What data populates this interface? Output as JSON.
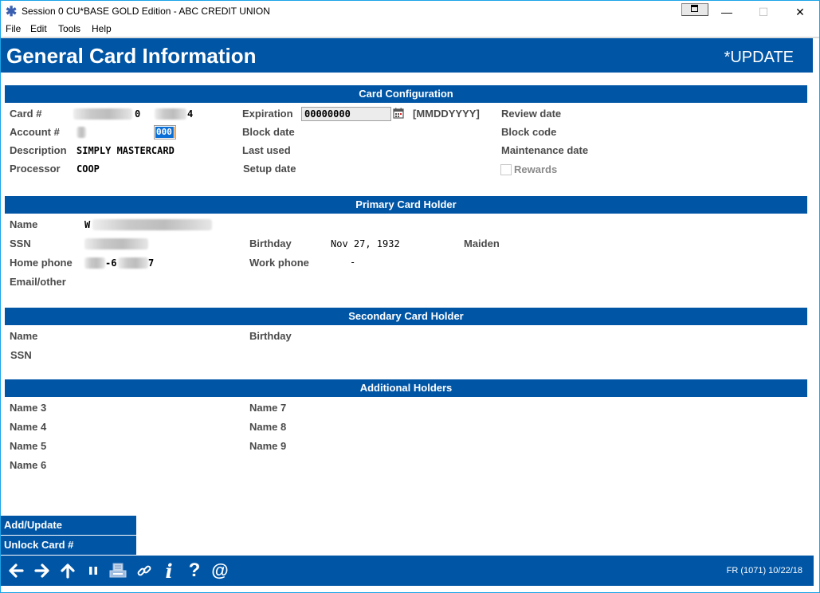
{
  "window": {
    "title": "Session 0 CU*BASE GOLD Edition - ABC CREDIT UNION",
    "controls": {
      "minimize": "—",
      "maximize": "☐",
      "close": "✕"
    }
  },
  "menu": [
    "File",
    "Edit",
    "Tools",
    "Help"
  ],
  "header": {
    "title": "General Card Information",
    "mode": "*UPDATE"
  },
  "card_configuration": {
    "title": "Card Configuration",
    "card_label": "Card #",
    "card_value_suffix_1": "0",
    "card_value_suffix_2": "4",
    "account_label": "Account #",
    "account_sub_value": "000",
    "description_label": "Description",
    "description_value": "SIMPLY MASTERCARD",
    "processor_label": "Processor",
    "processor_value": "COOP",
    "expiration_label": "Expiration",
    "expiration_value": "00000000",
    "expiration_format": "[MMDDYYYY]",
    "block_date_label": "Block date",
    "last_used_label": "Last used",
    "setup_date_label": "Setup date",
    "review_date_label": "Review date",
    "block_code_label": "Block code",
    "maintenance_date_label": "Maintenance date",
    "rewards_label": "Rewards",
    "rewards_checked": false
  },
  "primary_holder": {
    "title": "Primary Card Holder",
    "name_label": "Name",
    "name_prefix": "W",
    "ssn_label": "SSN",
    "home_phone_label": "Home phone",
    "home_phone_mid": "-6",
    "home_phone_end": "7",
    "email_label": "Email/other",
    "birthday_label": "Birthday",
    "birthday_value": "Nov 27, 1932",
    "work_phone_label": "Work phone",
    "work_phone_value": "-",
    "maiden_label": "Maiden"
  },
  "secondary_holder": {
    "title": "Secondary Card Holder",
    "name_label": "Name",
    "ssn_label": "SSN",
    "birthday_label": "Birthday"
  },
  "additional_holders": {
    "title": "Additional Holders",
    "left": [
      "Name 3",
      "Name 4",
      "Name 5",
      "Name 6"
    ],
    "right": [
      "Name 7",
      "Name 8",
      "Name 9"
    ]
  },
  "actions": [
    "Add/Update",
    "Unlock Card #"
  ],
  "footer": {
    "icons": [
      "back-arrow",
      "forward-arrow",
      "up-arrow",
      "pause",
      "print",
      "link",
      "info",
      "help",
      "email"
    ],
    "status": "FR (1071) 10/22/18"
  },
  "colors": {
    "brand_blue": "#0055a5",
    "label_gray": "#4a4a4a"
  }
}
